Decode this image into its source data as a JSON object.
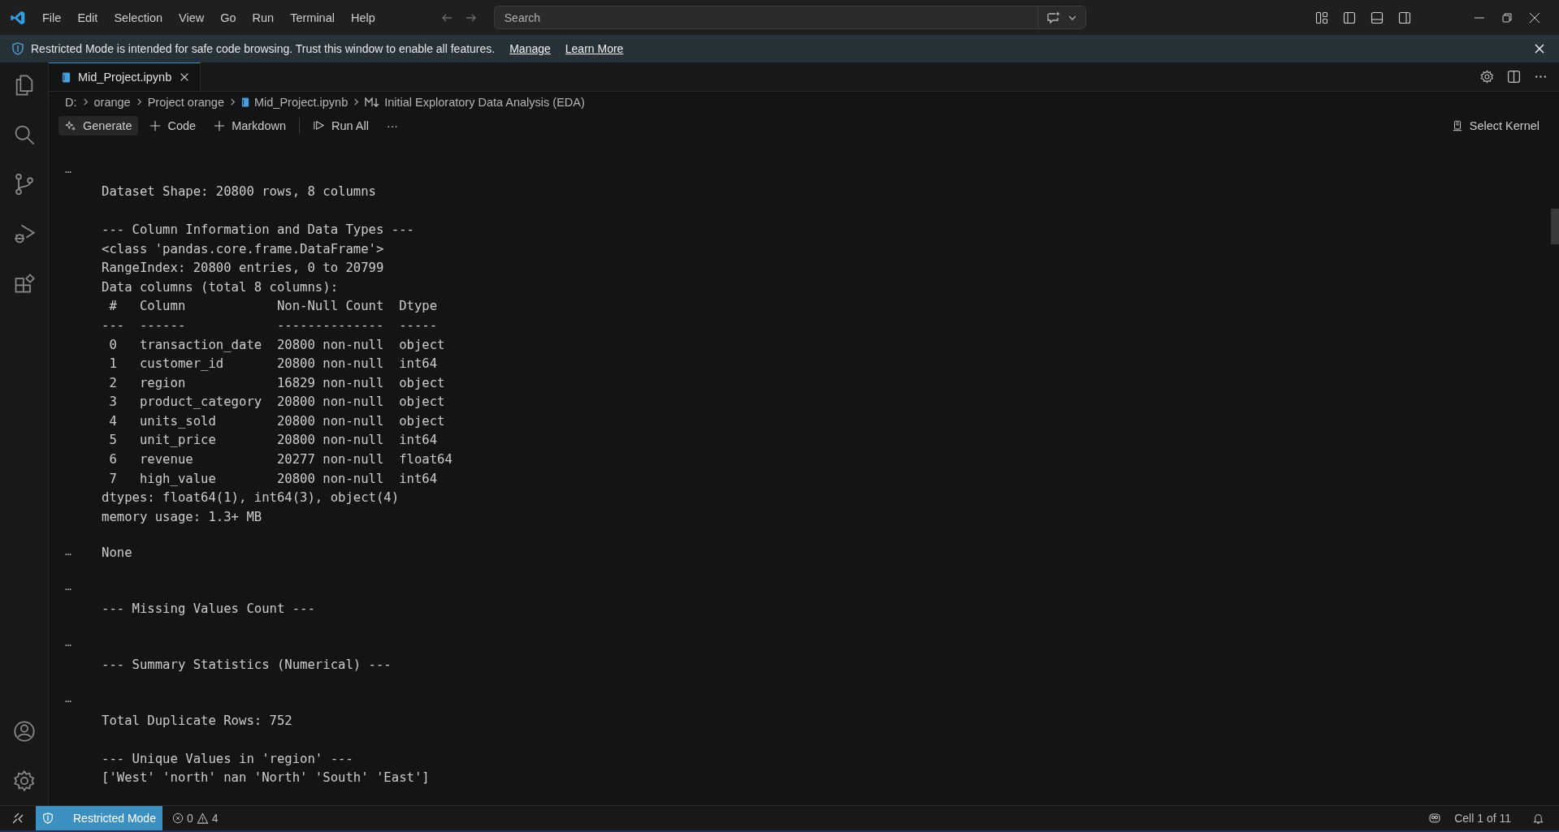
{
  "menu": [
    "File",
    "Edit",
    "Selection",
    "View",
    "Go",
    "Run",
    "Terminal",
    "Help"
  ],
  "search": {
    "placeholder": "Search"
  },
  "banner": {
    "message": "Restricted Mode is intended for safe code browsing. Trust this window to enable all features.",
    "links": [
      "Manage",
      "Learn More"
    ]
  },
  "tabs": [
    {
      "label": "Mid_Project.ipynb",
      "selected": true
    }
  ],
  "breadcrumb": [
    {
      "kind": "folder",
      "label": "D:"
    },
    {
      "kind": "folder",
      "label": "orange"
    },
    {
      "kind": "folder",
      "label": "Project orange"
    },
    {
      "kind": "notebook",
      "label": "Mid_Project.ipynb"
    },
    {
      "kind": "markdown",
      "label": "Initial Exploratory Data Analysis (EDA)"
    }
  ],
  "toolbar": [
    {
      "kind": "generate",
      "label": "Generate"
    },
    {
      "kind": "add",
      "label": "Code"
    },
    {
      "kind": "add",
      "label": "Markdown"
    },
    {
      "kind": "run",
      "label": "Run All"
    },
    {
      "kind": "more",
      "label": "···"
    }
  ],
  "kernel": {
    "label": "Select Kernel"
  },
  "outputs": [
    {
      "marker": "…",
      "inline": false,
      "paragraphs": [
        [
          "Dataset Shape: 20800 rows, 8 columns"
        ],
        [
          "--- Column Information and Data Types ---",
          "<class 'pandas.core.frame.DataFrame'>",
          "RangeIndex: 20800 entries, 0 to 20799",
          "Data columns (total 8 columns):",
          " #   Column            Non-Null Count  Dtype  ",
          "---  ------            --------------  -----  ",
          " 0   transaction_date  20800 non-null  object ",
          " 1   customer_id       20800 non-null  int64  ",
          " 2   region            16829 non-null  object ",
          " 3   product_category  20800 non-null  object ",
          " 4   units_sold        20800 non-null  object ",
          " 5   unit_price        20800 non-null  int64  ",
          " 6   revenue           20277 non-null  float64",
          " 7   high_value        20800 non-null  int64  ",
          "dtypes: float64(1), int64(3), object(4)",
          "memory usage: 1.3+ MB"
        ]
      ]
    },
    {
      "marker": "…",
      "inline": true,
      "paragraphs": [
        [
          "None"
        ]
      ]
    },
    {
      "marker": "…",
      "inline": false,
      "paragraphs": [
        [
          "--- Missing Values Count ---"
        ]
      ]
    },
    {
      "marker": "…",
      "inline": false,
      "paragraphs": [
        [
          "--- Summary Statistics (Numerical) ---"
        ]
      ]
    },
    {
      "marker": "…",
      "inline": false,
      "paragraphs": [
        [
          "Total Duplicate Rows: 752"
        ],
        [
          "--- Unique Values in 'region' ---",
          "['West' 'north' nan 'North' 'South' 'East']"
        ]
      ]
    }
  ],
  "status_bar": {
    "mode": "Restricted Mode",
    "errors": "0",
    "warnings": "4",
    "cell": "Cell 1 of 11"
  }
}
